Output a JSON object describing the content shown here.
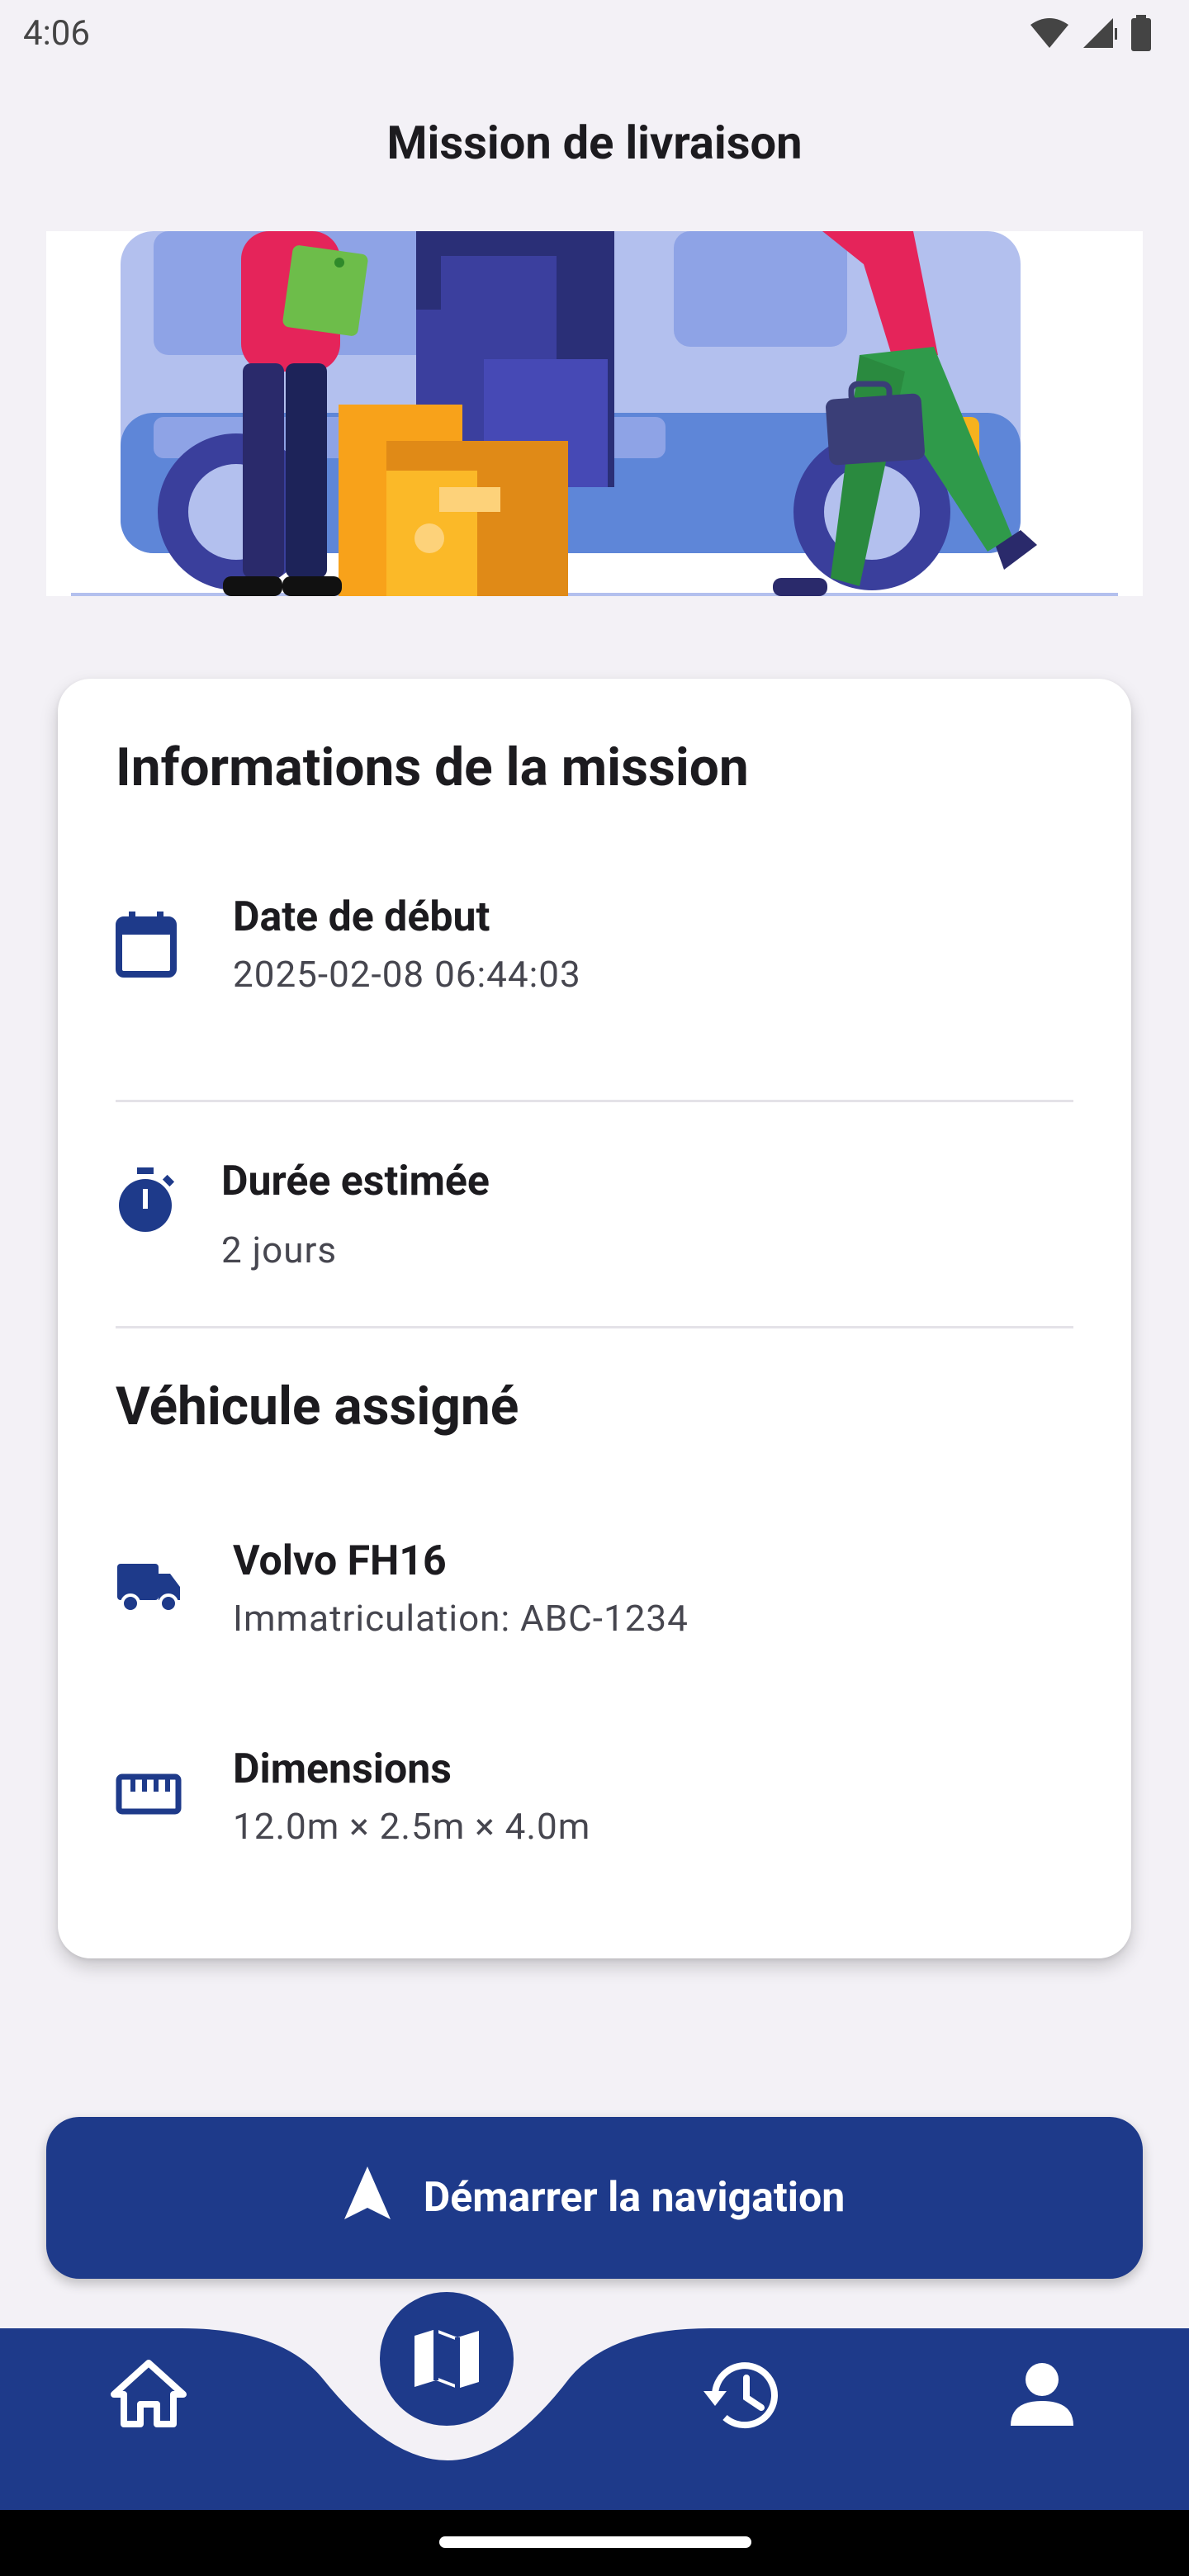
{
  "status_bar": {
    "time": "4:06"
  },
  "app_bar": {
    "title": "Mission de livraison"
  },
  "mission_info": {
    "title": "Informations de la mission",
    "start_date_label": "Date de début",
    "start_date_value": "2025-02-08 06:44:03",
    "duration_label": "Durée estimée",
    "duration_value": "2 jours"
  },
  "vehicle": {
    "title": "Véhicule assigné",
    "model": "Volvo FH16",
    "registration": "Immatriculation: ABC-1234",
    "dimensions_label": "Dimensions",
    "dimensions_value": "12.0m × 2.5m × 4.0m"
  },
  "actions": {
    "start_navigation": "Démarrer la navigation"
  },
  "colors": {
    "primary": "#1e3a8a",
    "background": "#f3f1f6",
    "card": "#ffffff"
  },
  "icons": {
    "start_date": "calendar-icon",
    "duration": "timer-icon",
    "vehicle": "truck-icon",
    "dimensions": "ruler-icon",
    "start_navigation": "navigation-arrow-icon",
    "nav_home": "home-icon",
    "nav_map": "map-icon",
    "nav_history": "history-icon",
    "nav_profile": "person-icon"
  }
}
